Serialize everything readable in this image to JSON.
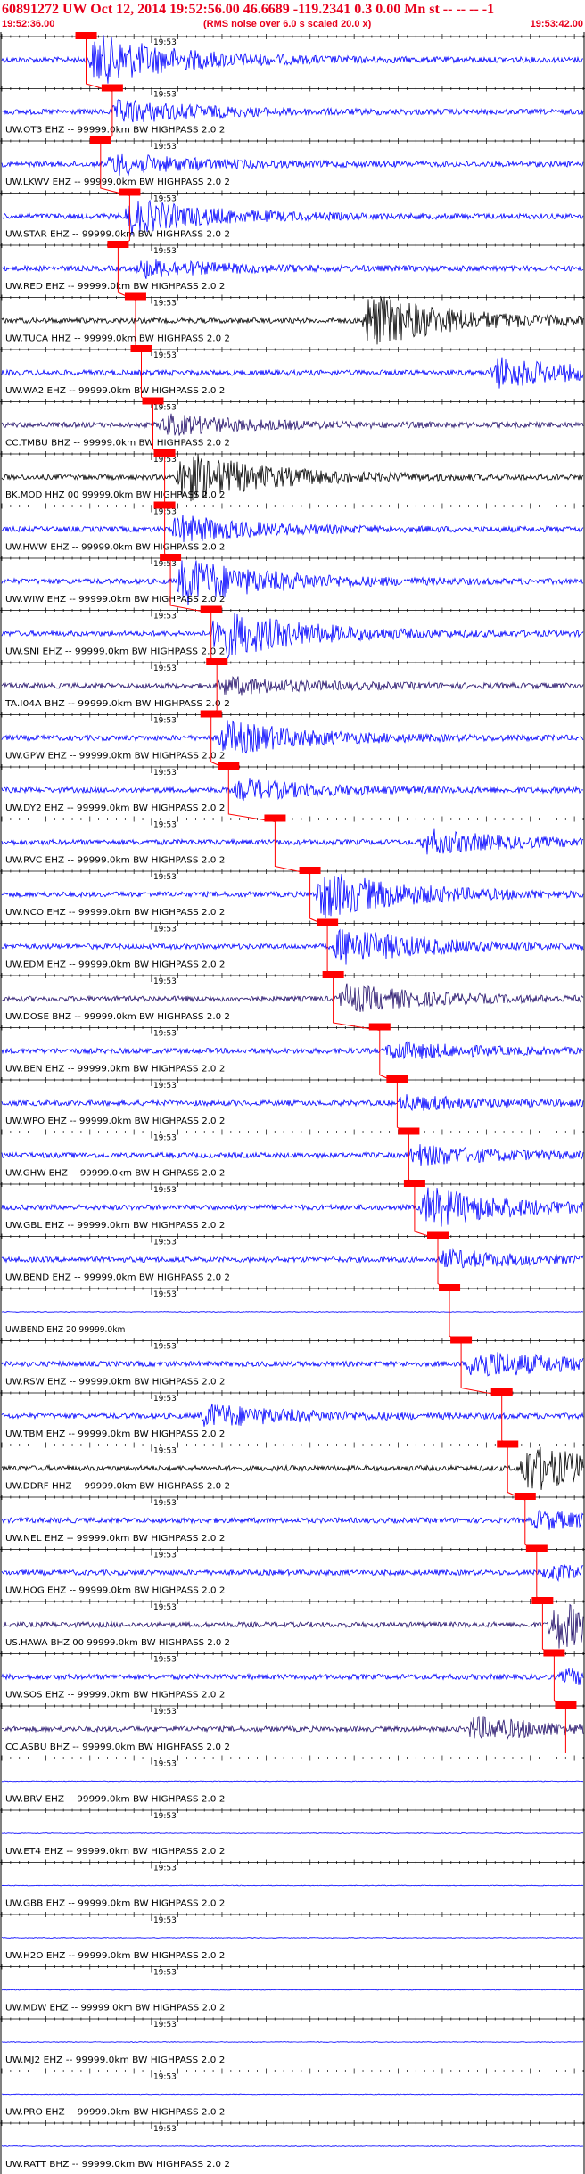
{
  "header": {
    "title": "60891272 UW Oct 12, 2014 19:52:56.00   46.6689 -119.2341  0.3 0.00 Mn st -- -- --  -1",
    "start_time": "19:52:36.00",
    "note": "(RMS noise over 6.0 s scaled 20.0 x)",
    "end_time": "19:53:42.00"
  },
  "chart_data": {
    "type": "line",
    "x_start_label": "19:52:36.00",
    "x_end_label": "19:53:42.00",
    "tick_label": "19:53",
    "colors": {
      "trace": "#0000ff",
      "dark": "#000000",
      "purple": "#24116b",
      "pick": "#ff0000",
      "header": "#e8001c"
    },
    "traces": [
      {
        "label": "",
        "color": "trace",
        "pick": 0.145,
        "amp": 30,
        "onset": 0.15
      },
      {
        "label": "UW.OT3 EHZ -- 99999.0km BW  HIGHPASS  2.0  2",
        "color": "trace",
        "pick": 0.19,
        "amp": 14,
        "onset": 0.19
      },
      {
        "label": "UW.LKWV EHZ -- 99999.0km BW  HIGHPASS  2.0  2",
        "color": "trace",
        "pick": 0.17,
        "amp": 12,
        "onset": 0.18
      },
      {
        "label": "UW.STAR EHZ -- 99999.0km BW  HIGHPASS  2.0  2",
        "color": "trace",
        "pick": 0.22,
        "amp": 20,
        "onset": 0.21
      },
      {
        "label": "UW.RED EHZ -- 99999.0km BW  HIGHPASS  2.0  2",
        "color": "trace",
        "pick": 0.2,
        "amp": 10,
        "onset": 0.23
      },
      {
        "label": "UW.TUCA HHZ -- 99999.0km BW  HIGHPASS  2.0  2",
        "color": "dark",
        "pick": 0.23,
        "amp": 32,
        "onset": 0.62
      },
      {
        "label": "UW.WA2 EHZ -- 99999.0km BW  HIGHPASS  2.0  2",
        "color": "trace",
        "pick": 0.24,
        "amp": 18,
        "onset": 0.84
      },
      {
        "label": "CC.TMBU BHZ -- 99999.0km BW  HIGHPASS  2.0  2",
        "color": "purple",
        "pick": 0.26,
        "amp": 12,
        "onset": 0.27
      },
      {
        "label": "BK.MOD HHZ 00 99999.0km BW  HIGHPASS  2.0  2",
        "color": "dark",
        "pick": 0.28,
        "amp": 30,
        "onset": 0.3
      },
      {
        "label": "UW.HWW EHZ -- 99999.0km BW  HIGHPASS  2.0  2",
        "color": "trace",
        "pick": 0.28,
        "amp": 16,
        "onset": 0.29
      },
      {
        "label": "UW.WIW EHZ -- 99999.0km BW  HIGHPASS  2.0  2",
        "color": "trace",
        "pick": 0.29,
        "amp": 28,
        "onset": 0.3
      },
      {
        "label": "UW.SNI EHZ -- 99999.0km BW  HIGHPASS  2.0  2",
        "color": "trace",
        "pick": 0.36,
        "amp": 30,
        "onset": 0.36
      },
      {
        "label": "TA.I04A BHZ -- 99999.0km BW  HIGHPASS  2.0  2",
        "color": "purple",
        "pick": 0.37,
        "amp": 10,
        "onset": 0.37
      },
      {
        "label": "UW.GPW EHZ -- 99999.0km BW  HIGHPASS  2.0  2",
        "color": "trace",
        "pick": 0.36,
        "amp": 20,
        "onset": 0.37
      },
      {
        "label": "UW.DY2 EHZ -- 99999.0km BW  HIGHPASS  2.0  2",
        "color": "trace",
        "pick": 0.39,
        "amp": 12,
        "onset": 0.4
      },
      {
        "label": "UW.RVC EHZ -- 99999.0km BW  HIGHPASS  2.0  2",
        "color": "trace",
        "pick": 0.47,
        "amp": 14,
        "onset": 0.72
      },
      {
        "label": "UW.NCO EHZ -- 99999.0km BW  HIGHPASS  2.0  2",
        "color": "trace",
        "pick": 0.53,
        "amp": 28,
        "onset": 0.54
      },
      {
        "label": "UW.EDM EHZ -- 99999.0km BW  HIGHPASS  2.0  2",
        "color": "trace",
        "pick": 0.56,
        "amp": 22,
        "onset": 0.57
      },
      {
        "label": "UW.DOSE BHZ -- 99999.0km BW  HIGHPASS  2.0  2",
        "color": "purple",
        "pick": 0.57,
        "amp": 16,
        "onset": 0.58
      },
      {
        "label": "UW.BEN EHZ -- 99999.0km BW  HIGHPASS  2.0  2",
        "color": "trace",
        "pick": 0.65,
        "amp": 10,
        "onset": 0.66
      },
      {
        "label": "UW.WPO EHZ -- 99999.0km BW  HIGHPASS  2.0  2",
        "color": "trace",
        "pick": 0.68,
        "amp": 8,
        "onset": 0.68
      },
      {
        "label": "UW.GHW EHZ -- 99999.0km BW  HIGHPASS  2.0  2",
        "color": "trace",
        "pick": 0.7,
        "amp": 12,
        "onset": 0.7
      },
      {
        "label": "UW.GBL EHZ -- 99999.0km BW  HIGHPASS  2.0  2",
        "color": "trace",
        "pick": 0.71,
        "amp": 24,
        "onset": 0.72
      },
      {
        "label": "UW.BEND EHZ -- 99999.0km BW  HIGHPASS  2.0  2",
        "color": "trace",
        "pick": 0.75,
        "amp": 10,
        "onset": 0.75
      },
      {
        "label": "UW.BEND EHZ 20 99999.0km",
        "color": "trace",
        "pick": 0.77,
        "amp": 0,
        "onset": 0.99
      },
      {
        "label": "UW.RSW EHZ -- 99999.0km BW  HIGHPASS  2.0  2",
        "color": "trace",
        "pick": 0.79,
        "amp": 18,
        "onset": 0.8
      },
      {
        "label": "UW.TBM EHZ -- 99999.0km BW  HIGHPASS  2.0  2",
        "color": "trace",
        "pick": 0.86,
        "amp": 14,
        "onset": 0.34
      },
      {
        "label": "UW.DDRF HHZ -- 99999.0km BW  HIGHPASS  2.0  2",
        "color": "dark",
        "pick": 0.87,
        "amp": 28,
        "onset": 0.89
      },
      {
        "label": "UW.NEL EHZ -- 99999.0km BW  HIGHPASS  2.0  2",
        "color": "trace",
        "pick": 0.9,
        "amp": 10,
        "onset": 0.91
      },
      {
        "label": "UW.HOG EHZ -- 99999.0km BW  HIGHPASS  2.0  2",
        "color": "trace",
        "pick": 0.92,
        "amp": 8,
        "onset": 0.93
      },
      {
        "label": "US.HAWA BHZ 00 99999.0km BW  HIGHPASS  2.0  2",
        "color": "purple",
        "pick": 0.93,
        "amp": 28,
        "onset": 0.94
      },
      {
        "label": "UW.SOS EHZ -- 99999.0km BW  HIGHPASS  2.0  2",
        "color": "trace",
        "pick": 0.95,
        "amp": 8,
        "onset": 0.96
      },
      {
        "label": "CC.ASBU BHZ -- 99999.0km BW  HIGHPASS  2.0  2",
        "color": "purple",
        "pick": 0.97,
        "amp": 14,
        "onset": 0.8
      },
      {
        "label": "UW.BRV EHZ -- 99999.0km BW  HIGHPASS  2.0  2",
        "color": "trace",
        "pick": null,
        "amp": 0,
        "onset": 1.0
      },
      {
        "label": "UW.ET4 EHZ -- 99999.0km BW  HIGHPASS  2.0  2",
        "color": "trace",
        "pick": null,
        "amp": 0,
        "onset": 1.0
      },
      {
        "label": "UW.GBB EHZ -- 99999.0km BW  HIGHPASS  2.0  2",
        "color": "trace",
        "pick": null,
        "amp": 0,
        "onset": 1.0
      },
      {
        "label": "UW.H2O EHZ -- 99999.0km BW  HIGHPASS  2.0  2",
        "color": "trace",
        "pick": null,
        "amp": 0,
        "onset": 1.0
      },
      {
        "label": "UW.MDW EHZ -- 99999.0km BW  HIGHPASS  2.0  2",
        "color": "trace",
        "pick": null,
        "amp": 0,
        "onset": 1.0
      },
      {
        "label": "UW.MJ2 EHZ -- 99999.0km BW  HIGHPASS  2.0  2",
        "color": "trace",
        "pick": null,
        "amp": 0,
        "onset": 1.0
      },
      {
        "label": "UW.PRO EHZ -- 99999.0km BW  HIGHPASS  2.0  2",
        "color": "trace",
        "pick": null,
        "amp": 0,
        "onset": 1.0
      },
      {
        "label": "UW.RATT BHZ -- 99999.0km BW  HIGHPASS  2.0  2",
        "color": "trace",
        "pick": null,
        "amp": 0,
        "onset": 1.0
      }
    ]
  }
}
